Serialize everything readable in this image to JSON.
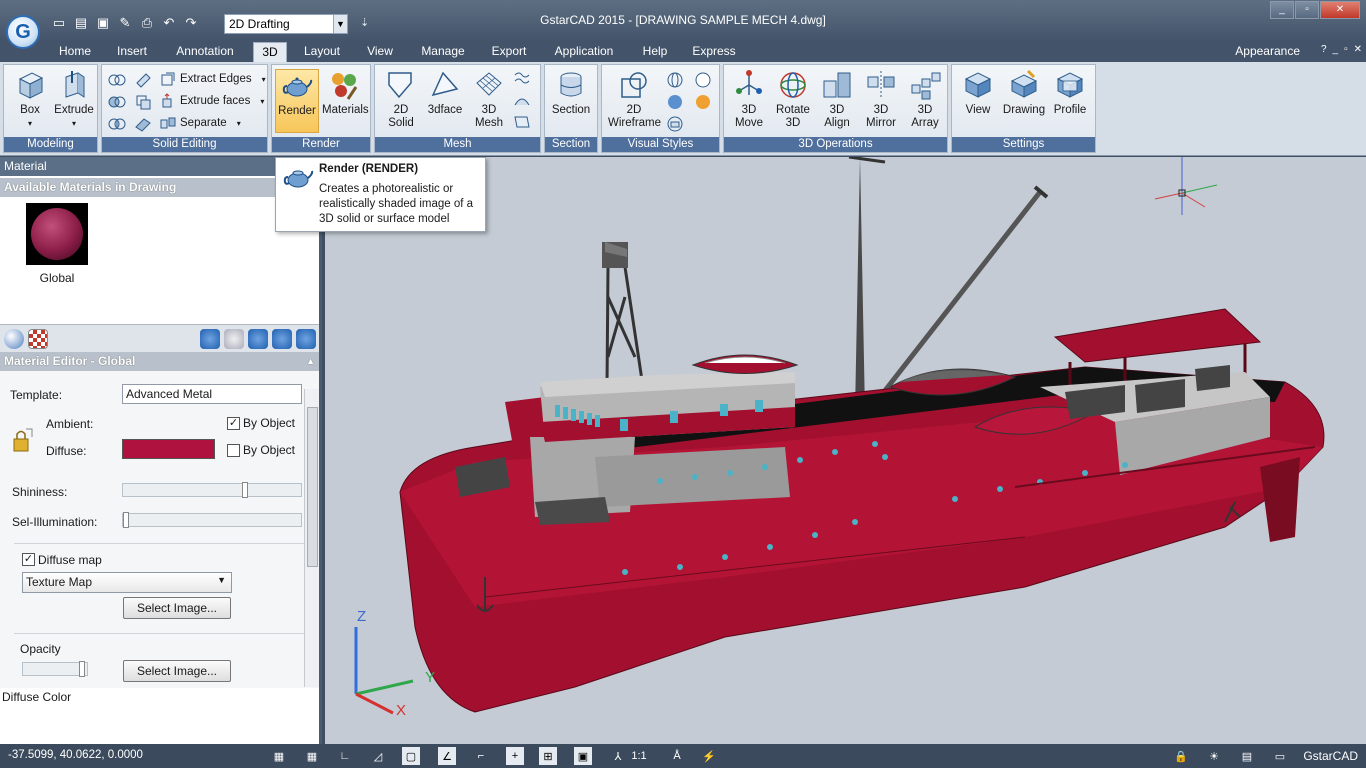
{
  "app": {
    "title": "GstarCAD 2015 - [DRAWING SAMPLE MECH 4.dwg]",
    "logo_letter": "G",
    "workspace": "2D Drafting",
    "appearance_label": "Appearance",
    "brand": "GstarCAD"
  },
  "menu": {
    "tabs": [
      "Home",
      "Insert",
      "Annotation",
      "3D",
      "Layout",
      "View",
      "Manage",
      "Export",
      "Application",
      "Help",
      "Express"
    ],
    "active": "3D"
  },
  "ribbon": {
    "modeling": {
      "title": "Modeling",
      "box": "Box",
      "extrude": "Extrude"
    },
    "solid_editing": {
      "title": "Solid Editing",
      "extract_edges": "Extract Edges",
      "extrude_faces": "Extrude faces",
      "separate": "Separate"
    },
    "render": {
      "title": "Render",
      "render": "Render",
      "materials": "Materials"
    },
    "mesh": {
      "title": "Mesh",
      "solid_2d_l1": "2D",
      "solid_2d_l2": "Solid",
      "face3d": "3dface",
      "mesh3d_l1": "3D",
      "mesh3d_l2": "Mesh"
    },
    "section": {
      "title": "Section",
      "section": "Section"
    },
    "visual_styles": {
      "title": "Visual Styles",
      "wire_l1": "2D",
      "wire_l2": "Wireframe"
    },
    "operations_3d": {
      "title": "3D Operations",
      "move_l1": "3D",
      "move_l2": "Move",
      "rotate_l1": "Rotate",
      "rotate_l2": "3D",
      "align_l1": "3D",
      "align_l2": "Align",
      "mirror_l1": "3D",
      "mirror_l2": "Mirror",
      "array_l1": "3D",
      "array_l2": "Array"
    },
    "settings": {
      "title": "Settings",
      "view": "View",
      "drawing": "Drawing",
      "profile": "Profile"
    }
  },
  "tooltip": {
    "title": "Render (RENDER)",
    "description": "Creates a photorealistic or realistically shaded image of a 3D solid or surface model"
  },
  "material_panel": {
    "header": "Material",
    "available_title": "Available Materials in Drawing",
    "material_name": "Global",
    "editor_title": "Material Editor - Global",
    "template_label": "Template:",
    "template_value": "Advanced Metal",
    "ambient_label": "Ambient:",
    "diffuse_label": "Diffuse:",
    "by_object_1": "By Object",
    "by_object_2": "By Object",
    "diffuse_color_hex": "#b0123f",
    "shininess_label": "Shininess:",
    "shininess_value": 0.7,
    "self_illum_label": "Sel-Illumination:",
    "self_illum_value": 0.0,
    "diffuse_map_label": "Diffuse map",
    "diffuse_map_type": "Texture Map",
    "select_image_1": "Select Image...",
    "opacity_label": "Opacity",
    "opacity_value": 1.0,
    "select_image_2": "Select Image...",
    "status_text": "Diffuse Color"
  },
  "viewport": {
    "axis_z": "Z",
    "axis_y": "Y",
    "axis_x": "X"
  },
  "status": {
    "coordinates": "-37.5099, 40.0622, 0.0000",
    "scale": "1:1"
  },
  "colors": {
    "hull": "#a3102f",
    "ribbon_title": "#4f6f9c",
    "viewport_bg": "#c4cbd4"
  }
}
